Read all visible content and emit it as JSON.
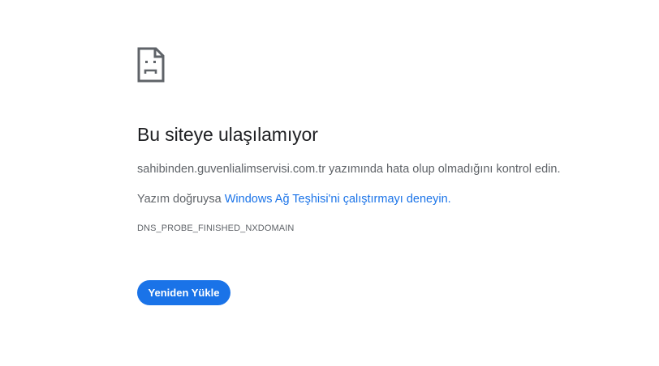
{
  "icon": "sad-page-icon",
  "colors": {
    "title": "#202124",
    "text": "#5f6368",
    "link": "#1a73e8",
    "button_bg": "#1a73e8",
    "button_text": "#ffffff"
  },
  "heading": "Bu siteye ulaşılamıyor",
  "message": "sahibinden.guvenlialimservisi.com.tr yazımında hata olup olmadığını kontrol edin.",
  "suggestion": {
    "prefix": "Yazım doğruysa ",
    "link_text": "Windows Ağ Teşhisi'ni çalıştırmayı deneyin."
  },
  "error_code": "DNS_PROBE_FINISHED_NXDOMAIN",
  "reload_button": "Yeniden Yükle"
}
